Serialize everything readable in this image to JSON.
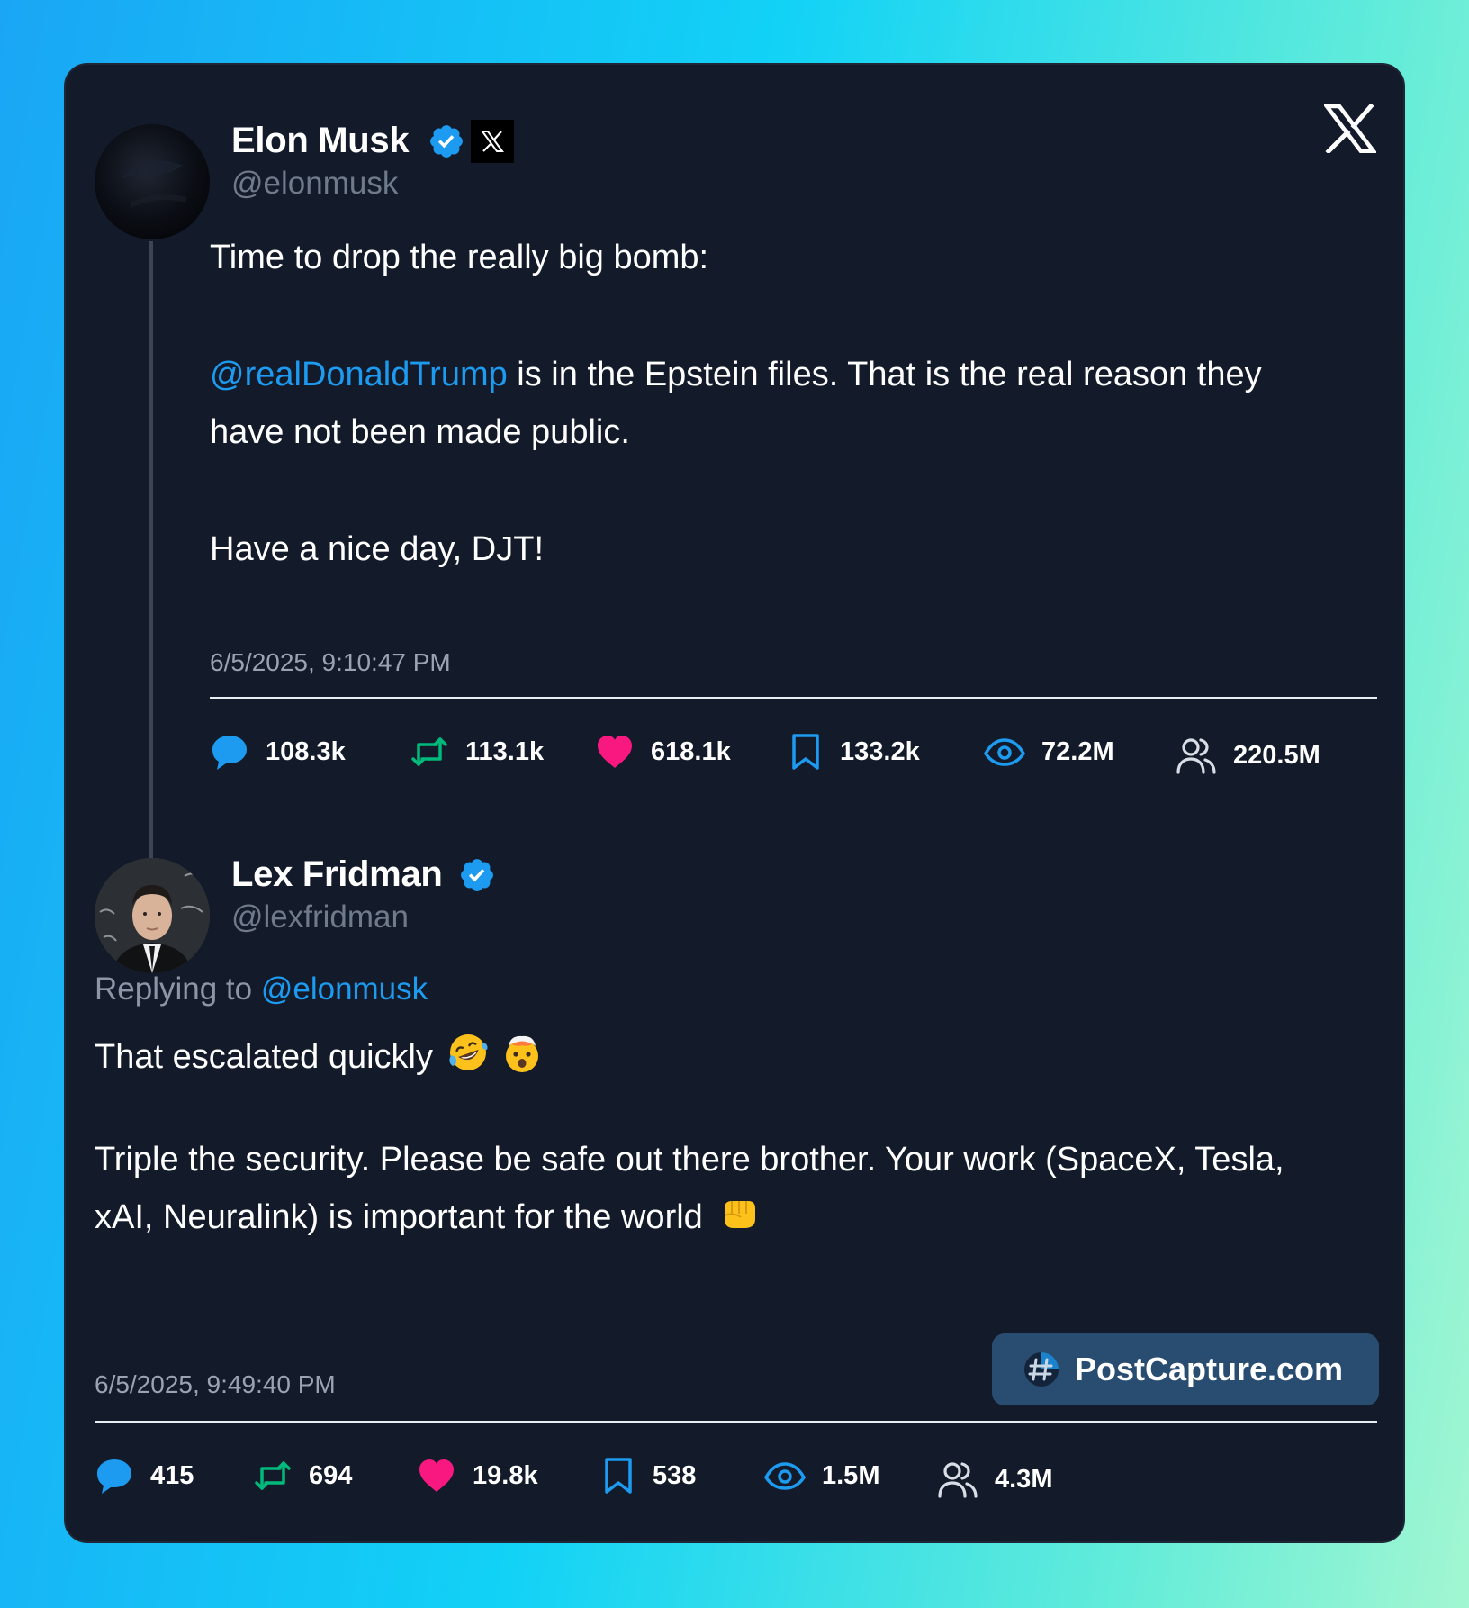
{
  "post1": {
    "name": "Elon Musk",
    "handle": "@elonmusk",
    "line1": "Time to drop the really big bomb:",
    "mention": "@realDonaldTrump",
    "line2": " is in the Epstein files. That is the real reason they",
    "line3": "have not been made public.",
    "line4": "Have a nice day, DJT!",
    "date": "6/5/2025, 9:10:47 PM",
    "stats": {
      "replies": "108.3k",
      "reposts": "113.1k",
      "likes": "618.1k",
      "bookmarks": "133.2k",
      "views": "72.2M",
      "reach": "220.5M"
    }
  },
  "post2": {
    "name": "Lex Fridman",
    "handle": "@lexfridman",
    "replying_prefix": "Replying to ",
    "replying_handle": "@elonmusk",
    "line1": "That escalated quickly",
    "line2": "Triple the security. Please be safe out there brother. Your work (SpaceX, Tesla,",
    "line3": "xAI, Neuralink) is important for the world",
    "date": "6/5/2025, 9:49:40 PM",
    "stats": {
      "replies": "415",
      "reposts": "694",
      "likes": "19.8k",
      "bookmarks": "538",
      "views": "1.5M",
      "reach": "4.3M"
    }
  },
  "watermark": {
    "label": "PostCapture.com"
  },
  "colors": {
    "card_bg": "#131a29",
    "link_blue": "#1d9bf0",
    "repost_green": "#00ba7c",
    "like_pink": "#f91880",
    "watermark_bg": "#294d70"
  },
  "icons": [
    "x-logo-icon",
    "verified-badge-icon",
    "x-affiliate-badge-icon",
    "reply-icon",
    "repost-icon",
    "like-icon",
    "bookmark-icon",
    "views-icon",
    "reach-icon",
    "laughing-emoji-icon",
    "exploding-head-emoji-icon",
    "fist-emoji-icon",
    "postcapture-logo-icon"
  ]
}
